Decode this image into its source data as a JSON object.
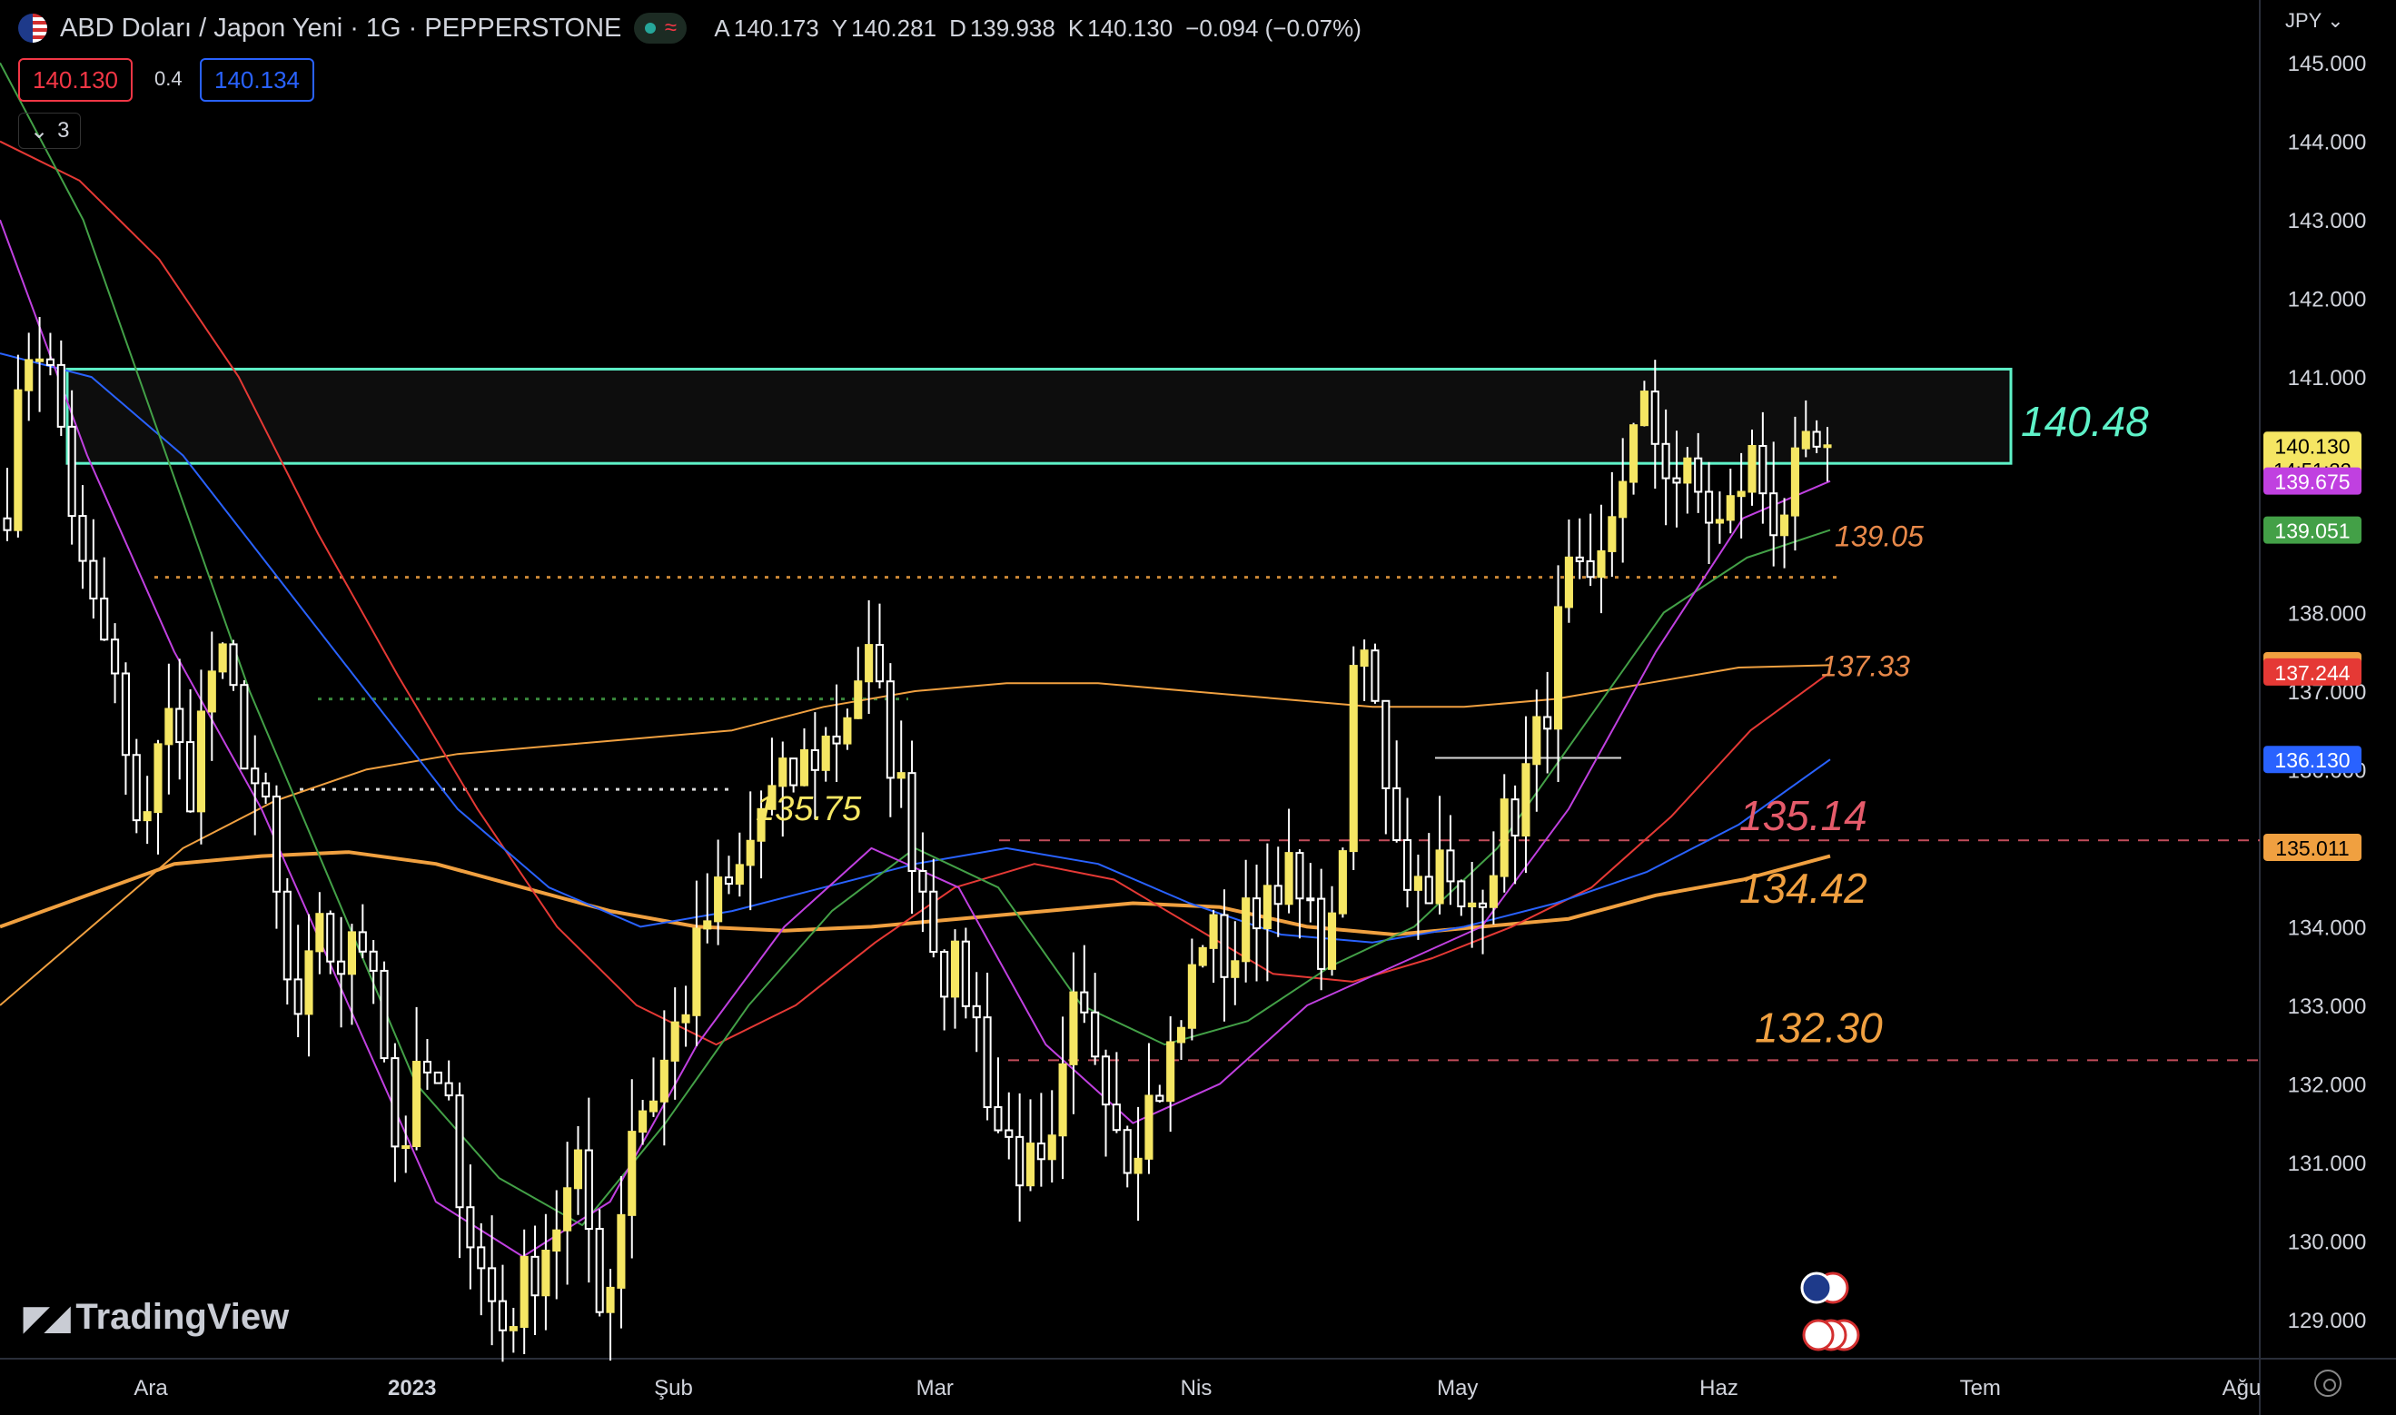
{
  "header": {
    "symbol": "ABD Doları / Japon Yeni · 1G · PEPPERSTONE",
    "status_icon": "≈",
    "ohlc": [
      {
        "key": "A",
        "value": "140.173"
      },
      {
        "key": "Y",
        "value": "140.281"
      },
      {
        "key": "D",
        "value": "139.938"
      },
      {
        "key": "K",
        "value": "140.130"
      }
    ],
    "change": "−0.094 (−0.07%)",
    "sell_price": "140.130",
    "spread": "0.4",
    "buy_price": "140.134",
    "indicators_collapsed_label": "3",
    "currency_menu": "JPY"
  },
  "brand": {
    "logo_text": "TradingView"
  },
  "colors": {
    "background": "#000000",
    "candle": "#f5e663",
    "zone": "#5ef2c8",
    "ma_orange": "#f0a040",
    "ma_red": "#e53935",
    "ma_blue": "#2962ff",
    "ma_green": "#43a047",
    "ma_purple": "#c040e0",
    "support_red": "#e55b6b"
  },
  "chart_data": {
    "type": "candlestick",
    "x_axis": {
      "ticks": [
        "Ara",
        "2023",
        "Şub",
        "Mar",
        "Nis",
        "May",
        "Haz",
        "Tem",
        "Ağu"
      ]
    },
    "y_axis": {
      "range": [
        128.5,
        145.8
      ],
      "ticks": [
        "145.000",
        "144.000",
        "143.000",
        "142.000",
        "141.000",
        "138.000",
        "137.000",
        "136.000",
        "134.000",
        "133.000",
        "132.000",
        "131.000",
        "130.000",
        "129.000"
      ]
    },
    "price_tags": [
      {
        "label": "140.130",
        "sublabel": "14:51:32",
        "value": 140.13,
        "bg": "#f5e663",
        "fg": "#000000"
      },
      {
        "label": "139.675",
        "value": 139.675,
        "bg": "#c040e0",
        "fg": "#ffffff"
      },
      {
        "label": "139.051",
        "value": 139.051,
        "bg": "#43a047",
        "fg": "#ffffff"
      },
      {
        "label": "137.324",
        "value": 137.324,
        "bg": "#f0a040",
        "fg": "#000000"
      },
      {
        "label": "137.244",
        "value": 137.244,
        "bg": "#e53935",
        "fg": "#ffffff"
      },
      {
        "label": "136.130",
        "value": 136.13,
        "bg": "#2962ff",
        "fg": "#ffffff"
      },
      {
        "label": "135.011",
        "value": 135.011,
        "bg": "#f0a040",
        "fg": "#000000"
      }
    ],
    "annotations": [
      {
        "text": "140.48",
        "value": 140.48,
        "color": "#5ef2c8"
      },
      {
        "text": "139.05",
        "value": 139.05,
        "color": "#e8894a"
      },
      {
        "text": "137.33",
        "value": 137.33,
        "color": "#e8894a"
      },
      {
        "text": "135.75",
        "value": 135.75,
        "color": "#f5e663"
      },
      {
        "text": "135.14",
        "value": 135.14,
        "color": "#e55b6b"
      },
      {
        "text": "134.42",
        "value": 134.42,
        "color": "#f0a040"
      },
      {
        "text": "132.30",
        "value": 132.3,
        "color": "#f0a040"
      }
    ],
    "resistance_zone": {
      "top": 141.1,
      "bottom": 139.9
    },
    "horizontal_levels": [
      {
        "value": 138.45,
        "style": "dotted",
        "color": "#f0a040"
      },
      {
        "value": 136.9,
        "style": "dotted",
        "color": "#43a047"
      },
      {
        "value": 135.75,
        "style": "dotted",
        "color": "#ffffff"
      },
      {
        "value": 135.1,
        "style": "dashed",
        "color": "#e55b6b"
      },
      {
        "value": 132.3,
        "style": "dashed",
        "color": "#e55b6b"
      },
      {
        "value": 136.15,
        "style": "solid",
        "color": "#ffffff"
      }
    ],
    "anchor_closes": [
      139.5,
      141.8,
      140.5,
      138.2,
      137.4,
      135.0,
      136.8,
      135.8,
      137.5,
      136.5,
      135.2,
      132.6,
      133.8,
      133.5,
      134.0,
      131.0,
      132.2,
      131.5,
      129.8,
      128.9,
      129.5,
      130.2,
      130.8,
      129.0,
      131.5,
      132.0,
      133.0,
      134.2,
      134.5,
      135.5,
      135.8,
      136.2,
      136.5,
      137.5,
      136.2,
      134.8,
      133.5,
      133.2,
      131.5,
      131.0,
      130.6,
      132.8,
      132.5,
      131.2,
      131.8,
      132.5,
      134.0,
      133.5,
      134.3,
      134.8,
      134.0,
      133.8,
      137.8,
      136.0,
      134.5,
      134.8,
      134.0,
      134.9,
      135.5,
      136.5,
      138.4,
      138.0,
      139.8,
      140.5,
      139.8,
      139.5,
      139.0,
      140.0,
      139.2,
      139.8,
      140.13
    ],
    "ma_lines": [
      {
        "name": "MA200",
        "color": "#f0a040",
        "width": 4,
        "values": [
          134.0,
          134.4,
          134.8,
          134.9,
          134.95,
          134.8,
          134.5,
          134.2,
          134.0,
          133.95,
          134.0,
          134.1,
          134.2,
          134.3,
          134.25,
          134.0,
          133.9,
          134.0,
          134.1,
          134.4,
          134.6,
          134.9
        ]
      },
      {
        "name": "MA100",
        "color": "#f0a040",
        "width": 2,
        "values": [
          133.0,
          134.0,
          135.0,
          135.6,
          136.0,
          136.2,
          136.3,
          136.4,
          136.5,
          136.8,
          137.0,
          137.1,
          137.1,
          137.0,
          136.9,
          136.8,
          136.8,
          136.9,
          137.1,
          137.3,
          137.33
        ]
      },
      {
        "name": "MA50",
        "color": "#e53935",
        "width": 2,
        "values": [
          144.0,
          143.5,
          142.5,
          141.0,
          139.0,
          137.2,
          135.5,
          134.0,
          133.0,
          132.5,
          133.0,
          133.8,
          134.5,
          134.8,
          134.6,
          134.0,
          133.4,
          133.3,
          133.6,
          134.0,
          134.5,
          135.4,
          136.5,
          137.24
        ]
      },
      {
        "name": "MA30",
        "color": "#2962ff",
        "width": 2,
        "values": [
          141.3,
          141.0,
          140.0,
          138.5,
          137.0,
          135.5,
          134.5,
          134.0,
          134.2,
          134.5,
          134.8,
          135.0,
          134.8,
          134.3,
          133.9,
          133.8,
          134.0,
          134.3,
          134.7,
          135.3,
          136.13
        ]
      },
      {
        "name": "MA20",
        "color": "#43a047",
        "width": 2,
        "values": [
          145.0,
          143.0,
          140.0,
          137.0,
          134.5,
          132.0,
          130.8,
          130.2,
          131.5,
          133.0,
          134.2,
          135.0,
          134.5,
          133.0,
          132.5,
          132.8,
          133.5,
          134.0,
          135.0,
          136.5,
          138.0,
          138.7,
          139.051
        ]
      },
      {
        "name": "MA10",
        "color": "#c040e0",
        "width": 2,
        "values": [
          143.0,
          140.0,
          137.5,
          135.5,
          133.0,
          130.5,
          129.8,
          130.5,
          132.5,
          134.0,
          135.0,
          134.5,
          132.5,
          131.5,
          132.0,
          133.0,
          133.5,
          134.0,
          135.5,
          137.5,
          139.2,
          139.675
        ]
      }
    ]
  }
}
